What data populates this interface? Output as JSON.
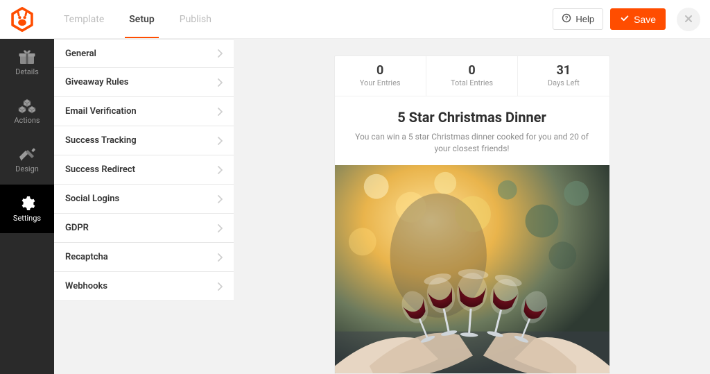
{
  "topbar": {
    "tabs": [
      {
        "label": "Template",
        "active": false
      },
      {
        "label": "Setup",
        "active": true
      },
      {
        "label": "Publish",
        "active": false
      }
    ],
    "help_label": "Help",
    "save_label": "Save"
  },
  "left_nav": {
    "items": [
      {
        "label": "Details",
        "icon": "gift-icon",
        "active": false
      },
      {
        "label": "Actions",
        "icon": "cubes-icon",
        "active": false
      },
      {
        "label": "Design",
        "icon": "brush-icon",
        "active": false
      },
      {
        "label": "Settings",
        "icon": "gear-icon",
        "active": true
      }
    ]
  },
  "settings_panel": {
    "items": [
      {
        "label": "General"
      },
      {
        "label": "Giveaway Rules"
      },
      {
        "label": "Email Verification"
      },
      {
        "label": "Success Tracking"
      },
      {
        "label": "Success Redirect"
      },
      {
        "label": "Social Logins"
      },
      {
        "label": "GDPR"
      },
      {
        "label": "Recaptcha"
      },
      {
        "label": "Webhooks"
      }
    ]
  },
  "preview": {
    "stats": [
      {
        "value": "0",
        "label": "Your Entries"
      },
      {
        "value": "0",
        "label": "Total Entries"
      },
      {
        "value": "31",
        "label": "Days Left"
      }
    ],
    "title": "5 Star Christmas Dinner",
    "description": "You can win a 5 star Christmas dinner cooked for you and 20 of your closest friends!"
  },
  "colors": {
    "brand": "#ff4d00",
    "sidebar_bg": "#2a2a2a",
    "page_bg": "#f2f2f2"
  }
}
